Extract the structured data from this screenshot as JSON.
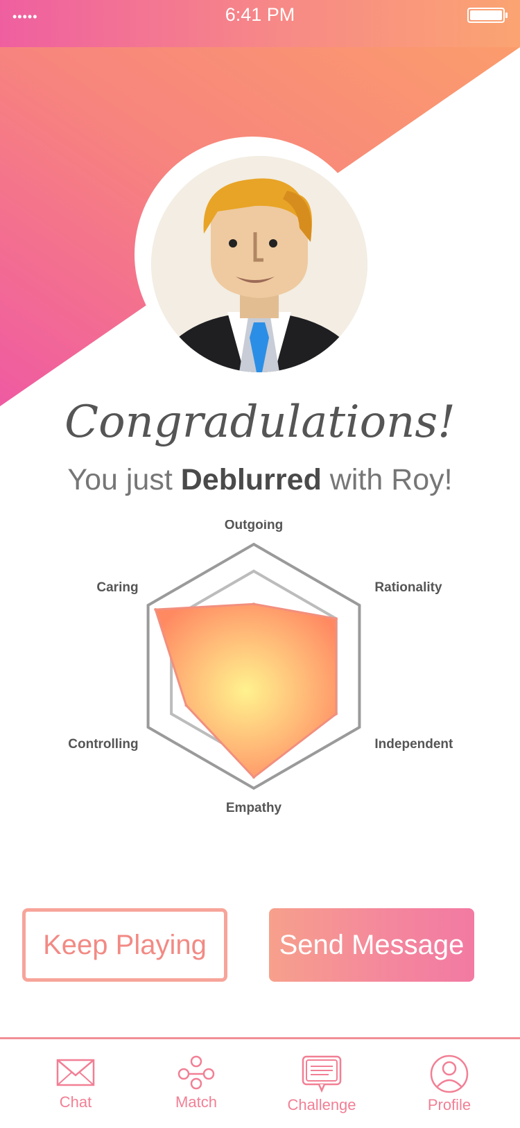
{
  "status_bar": {
    "signal": "•••••",
    "time": "6:41 PM"
  },
  "header": {
    "gradient_from": "#ef5fa0",
    "gradient_to": "#fba472"
  },
  "result": {
    "headline": "Congradulations!",
    "sub_prefix": "You just ",
    "sub_emphasis": "Deblurred",
    "sub_suffix": " with Roy!"
  },
  "chart_data": {
    "type": "radar",
    "axes": [
      "Outgoing",
      "Rationality",
      "Independent",
      "Empathy",
      "Controlling",
      "Caring"
    ],
    "series": [
      {
        "values": [
          0.51,
          0.78,
          0.78,
          0.91,
          0.64,
          0.93
        ],
        "color": "#ff9966"
      }
    ],
    "reference_rings": [
      0.78,
      1.0
    ],
    "range": [
      0,
      1
    ]
  },
  "actions": {
    "keep_playing": "Keep Playing",
    "send_message": "Send Message"
  },
  "tabbar": {
    "items": [
      {
        "label": "Chat",
        "icon": "envelope-icon"
      },
      {
        "label": "Match",
        "icon": "match-icon"
      },
      {
        "label": "Challenge",
        "icon": "chat-bubble-icon"
      },
      {
        "label": "Profile",
        "icon": "user-icon"
      }
    ],
    "accent": "#f27f94"
  }
}
